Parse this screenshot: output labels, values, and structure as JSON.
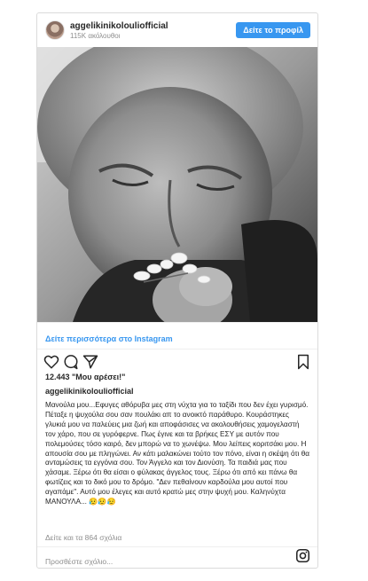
{
  "post": {
    "username": "aggelikinikolouliofficial",
    "followers": "115K ακόλουθοι",
    "profile_button": "Δείτε το προφίλ",
    "more_link": "Δείτε περισσότερα στο Instagram",
    "likes": "12.443 \"Μου αρέσει!\"",
    "caption_user": "aggelikinikolouliofficial",
    "caption": "Μανούλα μου...Εφυγες αθόρυβα μες στη νύχτα για το ταξίδι που δεν έχει γυρισμό. Πέταξε η ψυχούλα σου σαν πουλάκι απ το ανοικτό παράθυρο. Κουράστηκες γλυκιά μου να παλεύεις μια ζωή και αποφάσισες να ακολουθήσεις χαμογελαστή τον χάρο, που σε γυρόφερνε. Πως έγινε και τα βρήκες ΕΣΥ με αυτόν που πολεμούσες τόσο καιρό, δεν μπορώ να το χωνέψω. Μου λείπεις κοριτσάκι μου. Η απουσία σου με πληγώνει. Αν κάτι μαλακώνει τούτο τον πόνο, είναι η σκέψη ότι θα ανταμώσεις τα εγγόνια σου. Τον Άγγελο και τον Διονύση. Τα παιδιά μας που χάσαμε. Ξέρω ότι θα είσαι ο φύλακας άγγελος τους. Ξέρω ότι από κει πάνω θα φωτίζεις και το δικό μου το δρόμο. \"Δεν πεθαίνουν καρδούλα μου αυτοί που αγαπάμε\". Αυτό μου έλεγες και αυτό κρατώ μες στην ψυχή μου. Καληνύχτα ΜΑΝΟΥΛΑ... 😥😥😥",
    "view_comments": "Δείτε και τα 864 σχόλια",
    "add_comment_placeholder": "Προσθέστε σχόλιο..."
  },
  "icons": {
    "heart": "heart-icon",
    "comment": "comment-icon",
    "share": "share-icon",
    "bookmark": "bookmark-icon",
    "instagram": "instagram-icon"
  },
  "colors": {
    "accent": "#3897f0",
    "muted": "#8e8e8e",
    "text": "#262626"
  }
}
